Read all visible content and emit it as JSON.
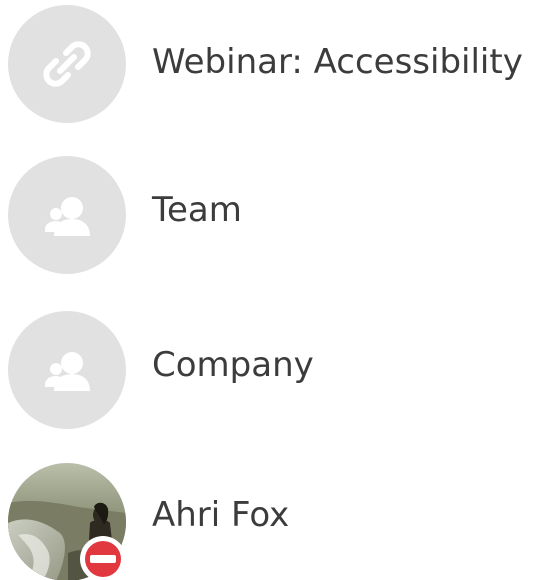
{
  "contacts": [
    {
      "label": "Webinar: Accessibility",
      "icon": "link-icon",
      "avatar_color": "#e1e1e1"
    },
    {
      "label": "Team",
      "icon": "group-icon",
      "avatar_color": "#e1e1e1"
    },
    {
      "label": "Company",
      "icon": "group-icon",
      "avatar_color": "#e1e1e1"
    },
    {
      "label": "Ahri Fox",
      "icon": "user-photo",
      "status": "do-not-disturb-icon",
      "status_color": "#e0383e"
    }
  ]
}
